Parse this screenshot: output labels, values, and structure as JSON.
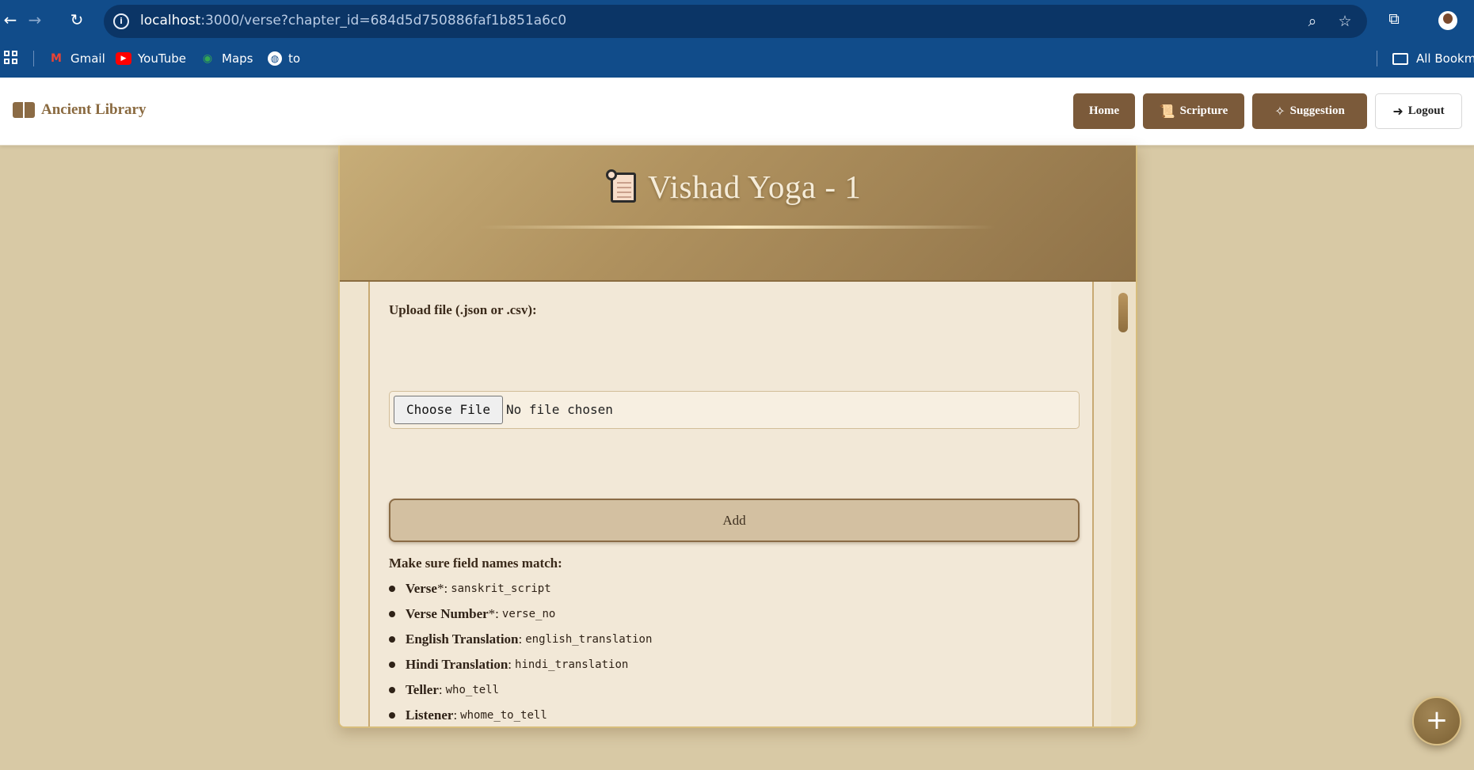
{
  "browser": {
    "url_host": "localhost",
    "url_rest": ":3000/verse?chapter_id=684d5d750886faf1b851a6c0",
    "bookmarks": [
      {
        "label": "Gmail",
        "icon": "gmail-icon"
      },
      {
        "label": "YouTube",
        "icon": "youtube-icon"
      },
      {
        "label": "Maps",
        "icon": "maps-icon"
      },
      {
        "label": "to",
        "icon": "globe-icon"
      }
    ],
    "all_bookmarks_label": "All Bookma"
  },
  "navbar": {
    "brand": "Ancient Library",
    "buttons": {
      "home": "Home",
      "scripture": "Scripture",
      "suggestion": "Suggestion",
      "logout": "Logout"
    }
  },
  "chapter": {
    "title": "Vishad Yoga - 1"
  },
  "upload": {
    "label": "Upload file (.json or .csv):",
    "choose_button": "Choose File",
    "file_status": "No file chosen",
    "add_button": "Add"
  },
  "fields": {
    "heading": "Make sure field names match:",
    "items": [
      {
        "name": "Verse",
        "suffix": "*:",
        "key": "sanskrit_script"
      },
      {
        "name": "Verse Number",
        "suffix": "*:",
        "key": "verse_no"
      },
      {
        "name": "English Translation",
        "suffix": ":",
        "key": "english_translation"
      },
      {
        "name": "Hindi Translation",
        "suffix": ":",
        "key": "hindi_translation"
      },
      {
        "name": "Teller",
        "suffix": ":",
        "key": "who_tell"
      },
      {
        "name": "Listener",
        "suffix": ":",
        "key": "whome_to_tell"
      }
    ]
  },
  "fab": {
    "symbol": "+"
  },
  "colors": {
    "accent_brown": "#7b5a3a",
    "page_background": "#d8c9a5",
    "browser_blue": "#114c8a"
  }
}
